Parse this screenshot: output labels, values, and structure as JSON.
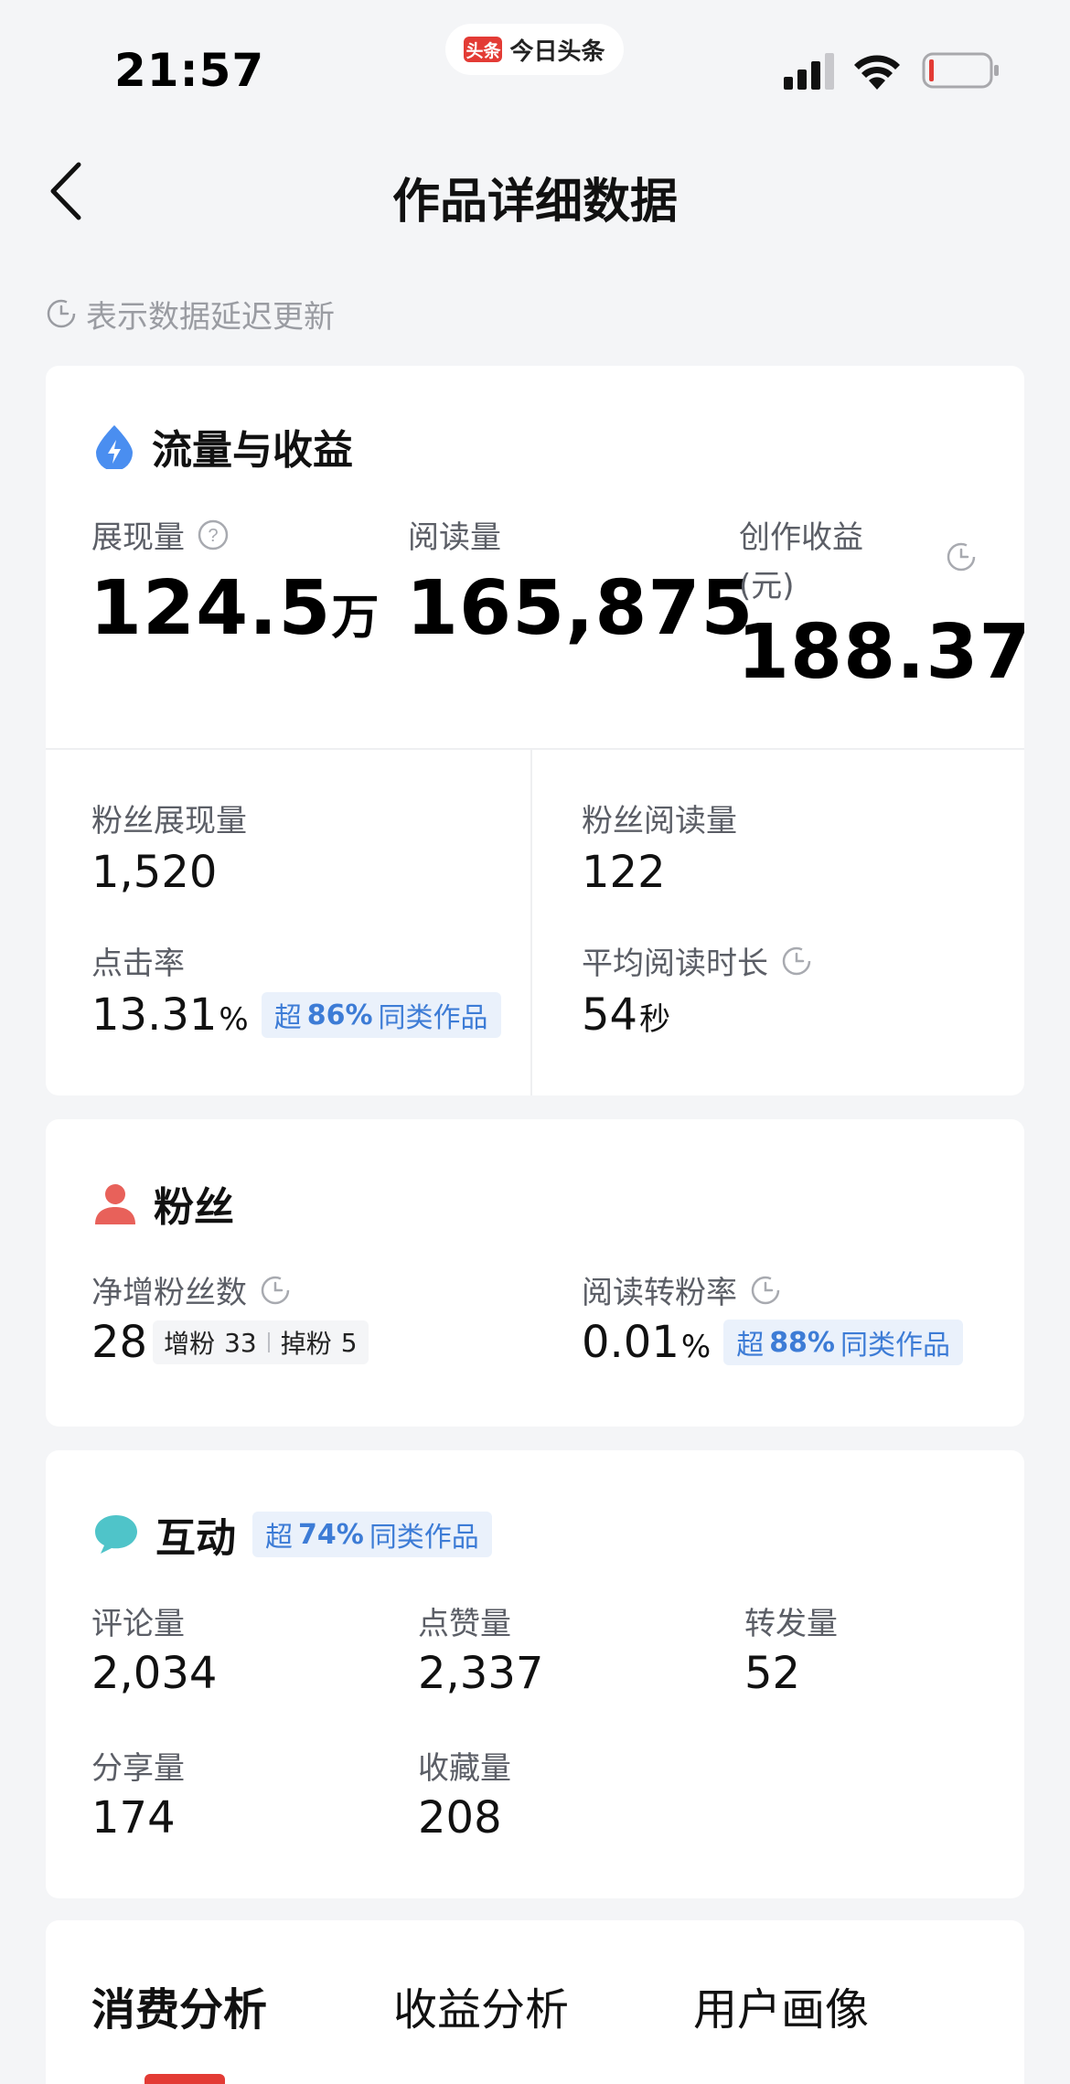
{
  "status_bar": {
    "time": "21:57",
    "app_logo": "头条",
    "app_name": "今日头条"
  },
  "nav": {
    "title": "作品详细数据"
  },
  "notice": {
    "text": "表示数据延迟更新"
  },
  "traffic": {
    "title": "流量与收益",
    "impressions": {
      "label": "展现量",
      "value": "124.5",
      "unit": "万"
    },
    "reads": {
      "label": "阅读量",
      "value": "165,875"
    },
    "earnings": {
      "label_line1": "创作收益",
      "label_line2": "(元)",
      "value": "188.37"
    },
    "fan_impressions": {
      "label": "粉丝展现量",
      "value": "1,520"
    },
    "fan_reads": {
      "label": "粉丝阅读量",
      "value": "122"
    },
    "ctr": {
      "label": "点击率",
      "value": "13.31",
      "unit": "%",
      "badge_prefix": "超",
      "badge_pct": "86%",
      "badge_suffix": "同类作品"
    },
    "avg_read_time": {
      "label": "平均阅读时长",
      "value": "54",
      "unit": "秒"
    }
  },
  "fans": {
    "title": "粉丝",
    "net_gain": {
      "label": "净增粉丝数",
      "value": "28",
      "gain_label": "增粉",
      "gain_value": "33",
      "loss_label": "掉粉",
      "loss_value": "5"
    },
    "conversion": {
      "label": "阅读转粉率",
      "value": "0.01",
      "unit": "%",
      "badge_prefix": "超",
      "badge_pct": "88%",
      "badge_suffix": "同类作品"
    }
  },
  "interaction": {
    "title": "互动",
    "badge_prefix": "超",
    "badge_pct": "74%",
    "badge_suffix": "同类作品",
    "comments": {
      "label": "评论量",
      "value": "2,034"
    },
    "likes": {
      "label": "点赞量",
      "value": "2,337"
    },
    "reposts": {
      "label": "转发量",
      "value": "52"
    },
    "shares": {
      "label": "分享量",
      "value": "174"
    },
    "favorites": {
      "label": "收藏量",
      "value": "208"
    }
  },
  "tabs": [
    {
      "label": "消费分析",
      "active": true
    },
    {
      "label": "收益分析",
      "active": false
    },
    {
      "label": "用户画像",
      "active": false
    }
  ],
  "colors": {
    "accent_red": "#e33b35",
    "badge_blue": "#3d7cd6",
    "fans_icon": "#e8615a",
    "traffic_icon": "#4a8ef0",
    "chat_icon": "#4fc4c9"
  }
}
